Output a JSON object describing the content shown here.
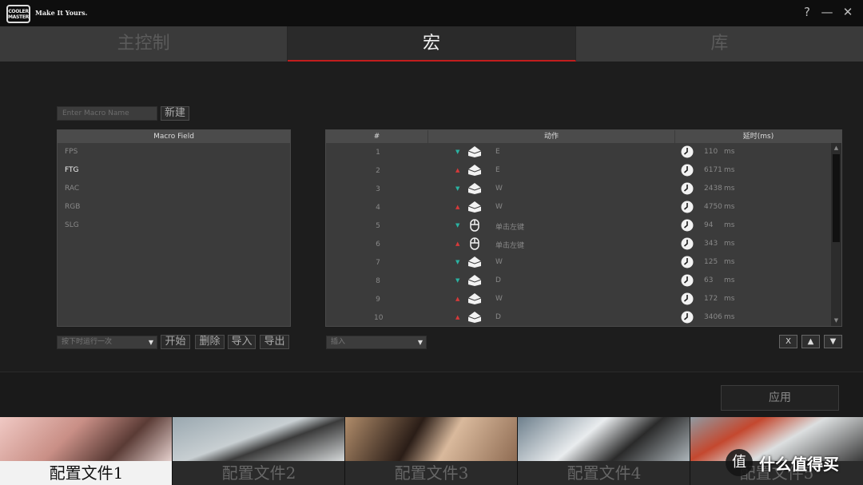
{
  "brand": {
    "logo_lines": [
      "COOLER",
      "MASTER"
    ],
    "tagline": "Make It Yours."
  },
  "window_controls": {
    "help": "?",
    "minimize": "—",
    "close": "✕"
  },
  "tabs": [
    {
      "label": "主控制",
      "active": false
    },
    {
      "label": "宏",
      "active": true
    },
    {
      "label": "库",
      "active": false
    }
  ],
  "macro_editor": {
    "name_placeholder": "Enter Macro Name",
    "new_button": "新建",
    "field_header": "Macro Field",
    "macros": [
      {
        "name": "FPS",
        "selected": false
      },
      {
        "name": "FTG",
        "selected": true
      },
      {
        "name": "RAC",
        "selected": false
      },
      {
        "name": "RGB",
        "selected": false
      },
      {
        "name": "SLG",
        "selected": false
      }
    ],
    "run_mode": "按下时运行一次",
    "buttons": {
      "start": "开始",
      "delete": "删除",
      "import": "导入",
      "export": "导出"
    }
  },
  "sequence": {
    "headers": {
      "num": "#",
      "action": "动作",
      "delay": "延时(ms)"
    },
    "unit": "ms",
    "rows": [
      {
        "num": "1",
        "dir": "down",
        "device": "keyboard",
        "action": "E",
        "delay": "110"
      },
      {
        "num": "2",
        "dir": "up",
        "device": "keyboard",
        "action": "E",
        "delay": "6171"
      },
      {
        "num": "3",
        "dir": "down",
        "device": "keyboard",
        "action": "W",
        "delay": "2438"
      },
      {
        "num": "4",
        "dir": "up",
        "device": "keyboard",
        "action": "W",
        "delay": "4750"
      },
      {
        "num": "5",
        "dir": "down",
        "device": "mouse",
        "action": "单击左键",
        "delay": "94"
      },
      {
        "num": "6",
        "dir": "up",
        "device": "mouse",
        "action": "单击左键",
        "delay": "343"
      },
      {
        "num": "7",
        "dir": "down",
        "device": "keyboard",
        "action": "W",
        "delay": "125"
      },
      {
        "num": "8",
        "dir": "down",
        "device": "keyboard",
        "action": "D",
        "delay": "63"
      },
      {
        "num": "9",
        "dir": "up",
        "device": "keyboard",
        "action": "W",
        "delay": "172"
      },
      {
        "num": "10",
        "dir": "up",
        "device": "keyboard",
        "action": "D",
        "delay": "3406"
      }
    ],
    "insert_dropdown": "插入",
    "tools": {
      "clear": "X",
      "up": "▲",
      "down": "▼"
    }
  },
  "apply_label": "应用",
  "profiles": [
    {
      "label": "配置文件1",
      "active": true
    },
    {
      "label": "配置文件2",
      "active": false
    },
    {
      "label": "配置文件3",
      "active": false
    },
    {
      "label": "配置文件4",
      "active": false
    },
    {
      "label": "配置文件5",
      "active": false
    }
  ],
  "watermark": {
    "glyph": "值",
    "text": "什么值得买"
  }
}
